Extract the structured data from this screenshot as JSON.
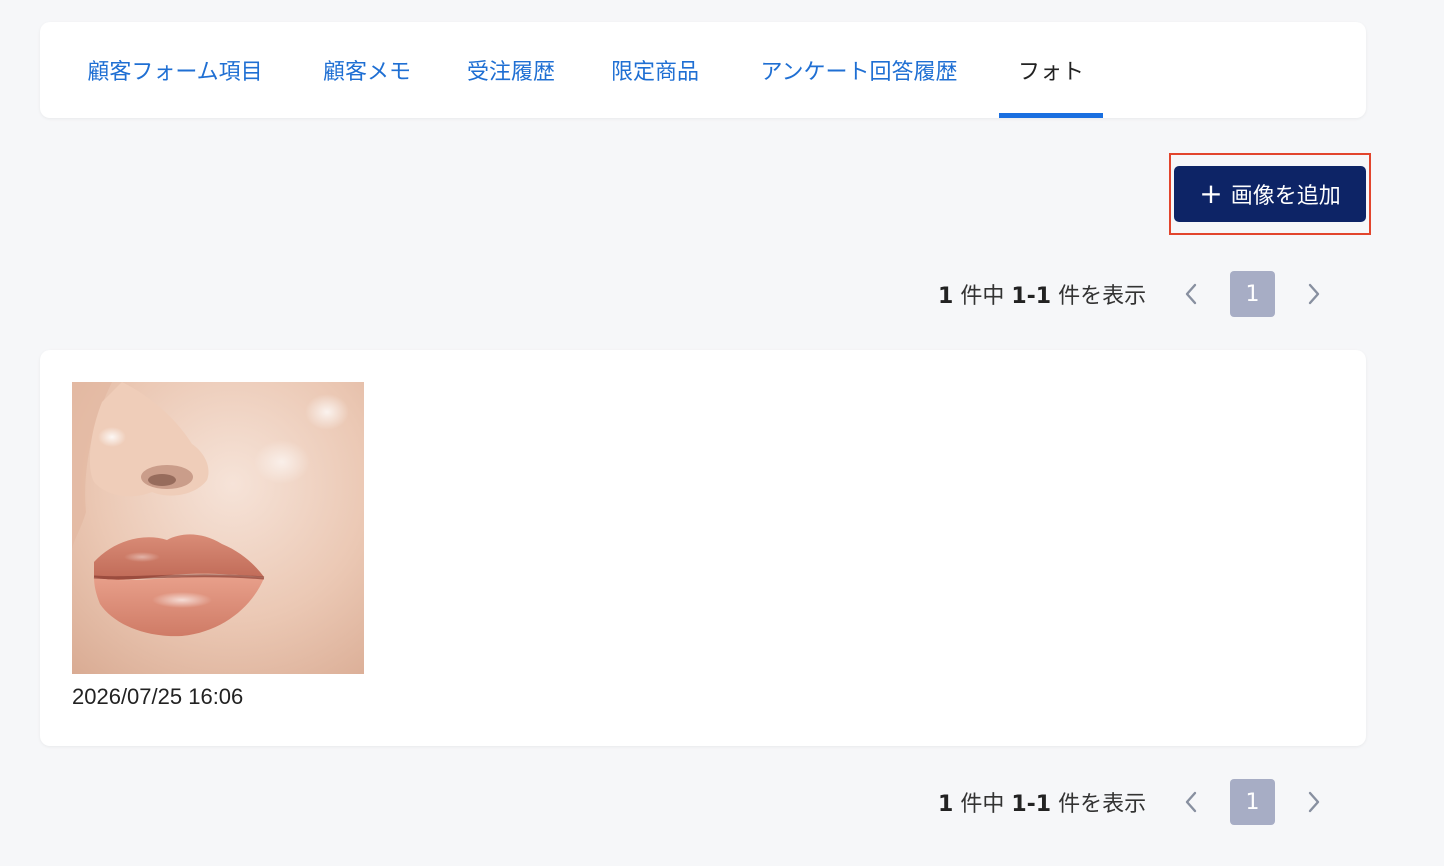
{
  "tabs": [
    {
      "label": "顧客フォーム項目",
      "active": false
    },
    {
      "label": "顧客メモ",
      "active": false
    },
    {
      "label": "受注履歴",
      "active": false
    },
    {
      "label": "限定商品",
      "active": false
    },
    {
      "label": "アンケート回答履歴",
      "active": false
    },
    {
      "label": "フォト",
      "active": true
    }
  ],
  "colors": {
    "tab_link": "#1f6fd3",
    "tab_active_underline": "#1a6fe0",
    "primary_button": "#0d2466",
    "highlight_border": "#e2452d",
    "page_current": "#a7adc5"
  },
  "toolbar": {
    "add_button_label": "画像を追加",
    "add_button_icon": "plus-icon"
  },
  "pagination_top": {
    "total": "1",
    "mid1": "件中",
    "range": "1-1",
    "mid2": "件を表示",
    "current_page": "1",
    "prev_icon": "chevron-left-icon",
    "next_icon": "chevron-right-icon"
  },
  "photos": [
    {
      "timestamp": "2026/07/25 16:06"
    }
  ],
  "pagination_bottom": {
    "total": "1",
    "mid1": "件中",
    "range": "1-1",
    "mid2": "件を表示",
    "current_page": "1",
    "prev_icon": "chevron-left-icon",
    "next_icon": "chevron-right-icon"
  }
}
